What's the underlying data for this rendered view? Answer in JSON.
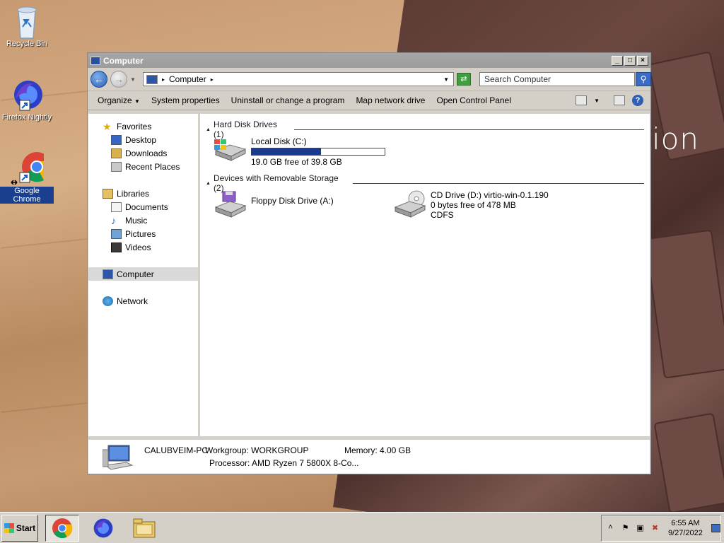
{
  "desktop": {
    "icons": [
      {
        "label": "Recycle Bin"
      },
      {
        "label": "Firefox Nightly"
      },
      {
        "label": "Google Chrome"
      }
    ],
    "wallpaper_text": "ion"
  },
  "window": {
    "title": "Computer",
    "controls": {
      "minimize": "_",
      "maximize": "□",
      "close": "×"
    },
    "address": {
      "path": "Computer"
    },
    "search": {
      "placeholder": "Search Computer"
    },
    "toolbar": {
      "organize": "Organize",
      "system_properties": "System properties",
      "uninstall": "Uninstall or change a program",
      "map_drive": "Map network drive",
      "control_panel": "Open Control Panel"
    },
    "nav": {
      "favorites": "Favorites",
      "desktop": "Desktop",
      "downloads": "Downloads",
      "recent": "Recent Places",
      "libraries": "Libraries",
      "documents": "Documents",
      "music": "Music",
      "pictures": "Pictures",
      "videos": "Videos",
      "computer": "Computer",
      "network": "Network"
    },
    "groups": {
      "hdd": "Hard Disk Drives (1)",
      "removable": "Devices with Removable Storage (2)"
    },
    "drives": {
      "c": {
        "name": "Local Disk (C:)",
        "free": "19.0 GB free of 39.8 GB",
        "used_fraction": 0.52
      },
      "a": {
        "name": "Floppy Disk Drive (A:)"
      },
      "d": {
        "name": "CD Drive (D:) virtio-win-0.1.190",
        "free": "0 bytes free of 478 MB",
        "fs": "CDFS"
      }
    },
    "details": {
      "pc_name": "CALUBVEIM-PC",
      "workgroup": "Workgroup: WORKGROUP",
      "memory": "Memory: 4.00 GB",
      "processor": "Processor: AMD Ryzen 7 5800X 8-Co..."
    }
  },
  "taskbar": {
    "start": "Start",
    "time": "6:55 AM",
    "date": "9/27/2022"
  }
}
